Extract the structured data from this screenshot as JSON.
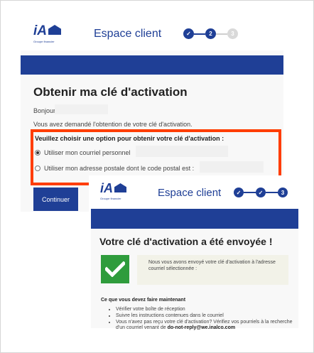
{
  "colors": {
    "brand_blue": "#1f3f96",
    "highlight_red": "#ff3d00",
    "success_green": "#2f9c3c"
  },
  "screen1": {
    "logo": {
      "text": "iA",
      "tagline": "Groupe financier"
    },
    "header_title": "Espace client",
    "steps": {
      "step1": "✓",
      "step2": "2",
      "step3": "3"
    },
    "heading": "Obtenir ma clé d'activation",
    "greeting": "Bonjour",
    "request_text": "Vous avez demandé l'obtention de votre clé d'activation.",
    "choose_label": "Veuillez choisir une option pour obtenir votre clé d'activation :",
    "option_email": "Utiliser mon courriel personnel",
    "option_postal": "Utiliser mon adresse postale dont le code postal est :",
    "continue_label": "Continuer"
  },
  "screen2": {
    "logo": {
      "text": "iA",
      "tagline": "Groupe financier"
    },
    "header_title": "Espace client",
    "steps": {
      "step1": "✓",
      "step2": "✓",
      "step3": "3"
    },
    "heading": "Votre clé d'activation a été envoyée !",
    "confirmation": "Nous vous avons envoyé votre clé d'activation à l'adresse courriel sélectionnée :",
    "todo_title": "Ce que vous devez faire maintenant",
    "todo_items": {
      "item1": "Vérifier votre boîte de réception",
      "item2": "Suivre les instructions contenues dans le courriel",
      "item3_prefix": "Vous n'avez pas reçu votre clé d'activation? Vérifiez vos pourriels à la recherche d'un courriel venant de ",
      "item3_email": "do-not-reply@we.inalco.com"
    }
  }
}
